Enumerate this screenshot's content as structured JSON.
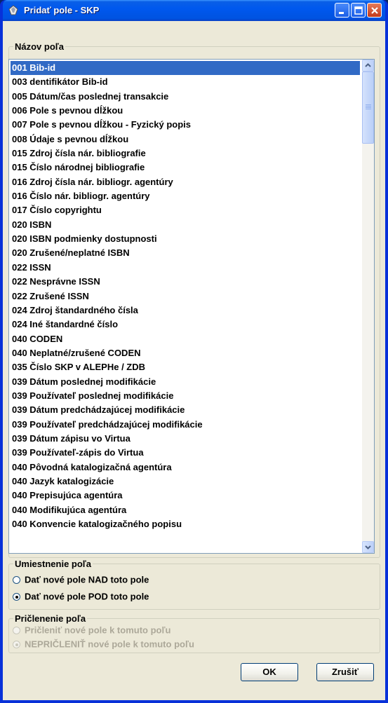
{
  "window": {
    "title": "Pridať pole - SKP",
    "icon": "app-icon",
    "controls": [
      "minimize-icon",
      "maximize-icon",
      "close-icon"
    ]
  },
  "field_name_group": {
    "title": "Názov poľa",
    "selected_index": 0,
    "items": [
      "001 Bib-id",
      "003 dentifikátor Bib-id",
      "005 Dátum/čas poslednej transakcie",
      "006 Pole s pevnou dĺžkou",
      "007 Pole s pevnou dĺžkou - Fyzický popis",
      "008 Údaje s pevnou dĺžkou",
      "015 Zdroj čísla nár. bibliografie",
      "015 Číslo národnej bibliografie",
      "016 Zdroj čísla nár. bibliogr. agentúry",
      "016 Číslo nár. bibliogr. agentúry",
      "017 Číslo copyrightu",
      "020 ISBN",
      "020 ISBN podmienky dostupnosti",
      "020 Zrušené/neplatné ISBN",
      "022 ISSN",
      "022 Nesprávne ISSN",
      "022 Zrušené ISSN",
      "024 Zdroj štandardného čísla",
      "024 Iné štandardné číslo",
      "040 CODEN",
      "040 Neplatné/zrušené CODEN",
      "035 Číslo SKP v ALEPHe / ZDB",
      "039 Dátum poslednej modifikácie",
      "039 Používateľ poslednej modifikácie",
      "039 Dátum predchádzajúcej modifikácie",
      "039 Používateľ predchádzajúcej modifikácie",
      "039 Dátum zápisu vo Virtua",
      "039 Používateľ-zápis do Virtua",
      "040 Pôvodná katalogizačná agentúra",
      "040 Jazyk katalogizácie",
      "040 Prepisujúca agentúra",
      "040 Modifikujúca agentúra",
      "040 Konvencie katalogizačného popisu"
    ]
  },
  "placement_group": {
    "title": "Umiestnenie poľa",
    "options": [
      {
        "label": "Dať nové pole NAD toto pole",
        "checked": false
      },
      {
        "label": "Dať nové pole POD toto pole",
        "checked": true
      }
    ]
  },
  "attach_group": {
    "title": "Pričlenenie poľa",
    "enabled": false,
    "options": [
      {
        "label": "Pričleniť nové pole k tomuto poľu",
        "checked": false
      },
      {
        "label": "NEPRIČLENIŤ nové pole k tomuto poľu",
        "checked": true
      }
    ]
  },
  "buttons": {
    "ok": "OK",
    "cancel": "Zrušiť"
  }
}
